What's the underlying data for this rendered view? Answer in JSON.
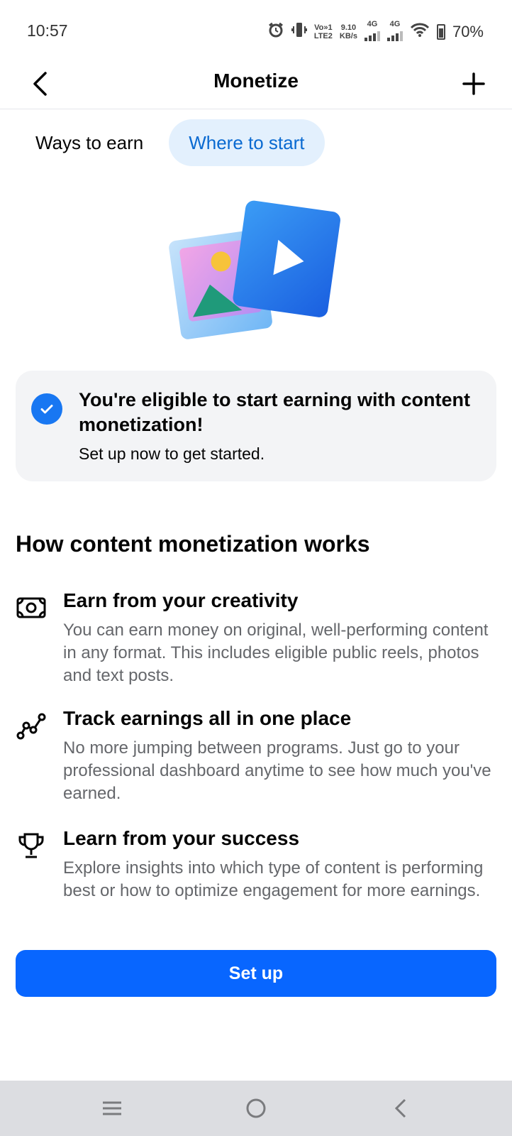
{
  "status_bar": {
    "time": "10:57",
    "volte": "Vo»1",
    "lte": "LTE2",
    "speed": "9.10",
    "speed_unit": "KB/s",
    "net1": "4G",
    "net2": "4G",
    "battery": "70%"
  },
  "header": {
    "title": "Monetize"
  },
  "tabs": [
    {
      "label": "Ways to earn",
      "active": false
    },
    {
      "label": "Where to start",
      "active": true
    }
  ],
  "eligible": {
    "title": "You're eligible to start earning with content monetization!",
    "subtitle": "Set up now to get started."
  },
  "how": {
    "title": "How content monetization works",
    "items": [
      {
        "icon": "money-icon",
        "title": "Earn from your creativity",
        "desc": "You can earn money on original, well-performing content in any format. This includes eligible public reels, photos and text posts."
      },
      {
        "icon": "chart-line-icon",
        "title": "Track earnings all in one place",
        "desc": "No more jumping between programs. Just go to your professional dashboard anytime to see how much you've earned."
      },
      {
        "icon": "trophy-icon",
        "title": "Learn from your success",
        "desc": "Explore insights into which type of content is performing best or how to optimize engagement for more earnings."
      }
    ]
  },
  "setup_button": "Set up",
  "colors": {
    "primary": "#0866ff",
    "tab_active_bg": "#e3f0fd",
    "tab_active_text": "#0a6ad1",
    "secondary_text": "#65676b",
    "card_bg": "#f3f4f6"
  }
}
